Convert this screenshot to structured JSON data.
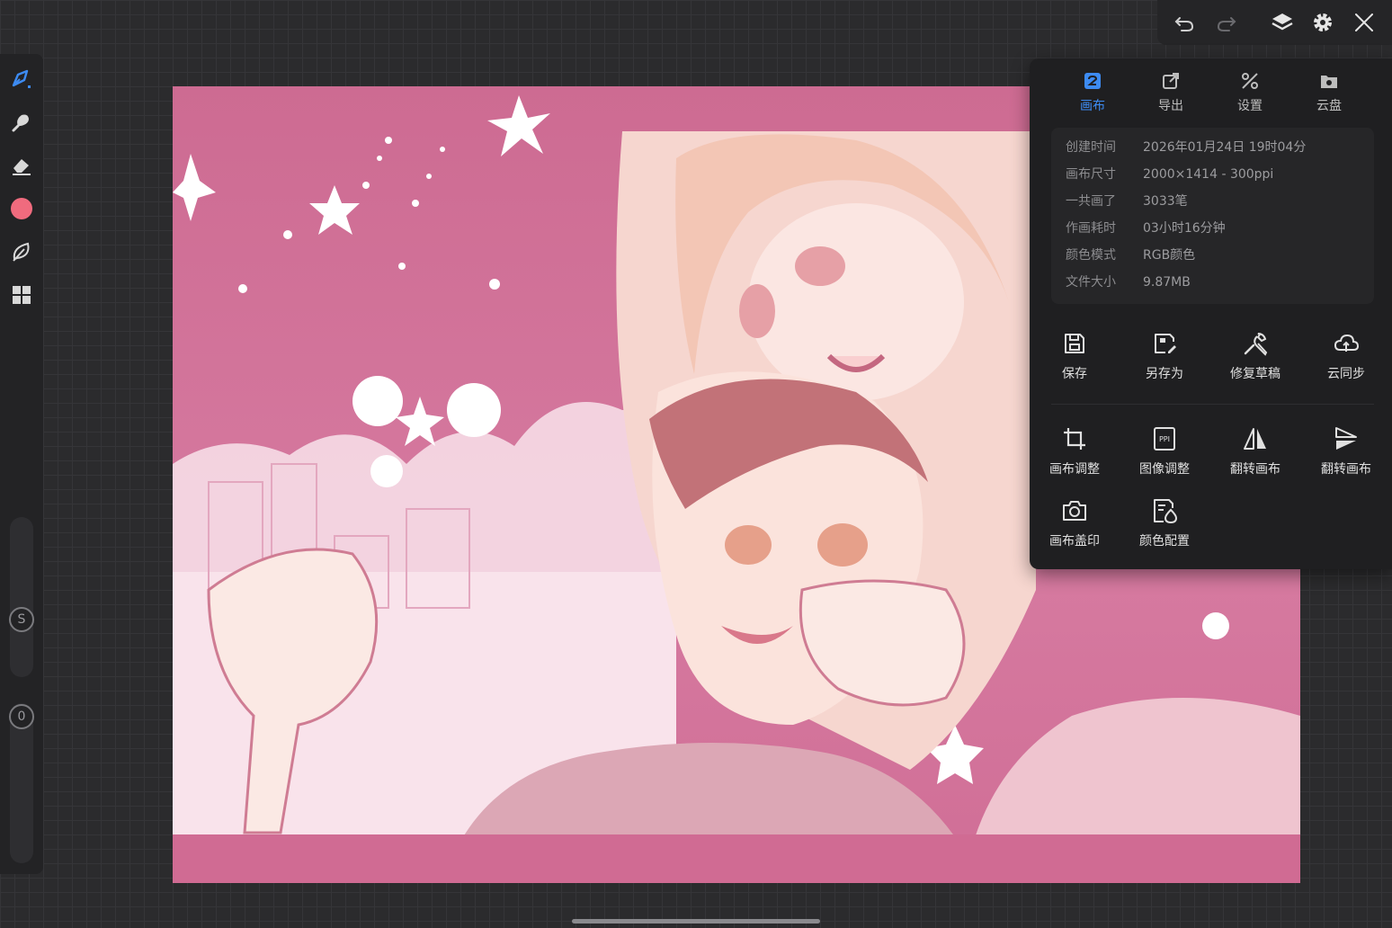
{
  "panel": {
    "tabs": [
      {
        "label": "画布",
        "icon": "canvas-icon",
        "active": true
      },
      {
        "label": "导出",
        "icon": "export-icon",
        "active": false
      },
      {
        "label": "设置",
        "icon": "settings-tools-icon",
        "active": false
      },
      {
        "label": "云盘",
        "icon": "cloud-folder-icon",
        "active": false
      }
    ],
    "info": [
      {
        "key": "创建时间",
        "value": "2026年01月24日 19时04分"
      },
      {
        "key": "画布尺寸",
        "value": "2000×1414 - 300ppi"
      },
      {
        "key": "一共画了",
        "value": "3033笔"
      },
      {
        "key": "作画耗时",
        "value": "03小时16分钟"
      },
      {
        "key": "颜色模式",
        "value": "RGB颜色"
      },
      {
        "key": "文件大小",
        "value": "9.87MB"
      }
    ],
    "actions": [
      {
        "label": "保存",
        "icon": "save-icon"
      },
      {
        "label": "另存为",
        "icon": "save-as-icon"
      },
      {
        "label": "修复草稿",
        "icon": "repair-icon"
      },
      {
        "label": "云同步",
        "icon": "cloud-sync-icon"
      },
      {
        "label": "画布调整",
        "icon": "crop-icon"
      },
      {
        "label": "图像调整",
        "icon": "ppi-icon"
      },
      {
        "label": "翻转画布",
        "icon": "flip-horizontal-icon"
      },
      {
        "label": "翻转画布",
        "icon": "flip-vertical-icon"
      },
      {
        "label": "画布盖印",
        "icon": "camera-icon"
      },
      {
        "label": "颜色配置",
        "icon": "color-profile-icon"
      }
    ]
  },
  "left_toolbar": {
    "brush_size_label": "S",
    "opacity_label": "0",
    "current_color": "#f06b7e"
  },
  "colors": {
    "accent": "#3d8bf2",
    "panel_bg": "#1f1f21",
    "canvas_pink": "#cd6b92"
  }
}
